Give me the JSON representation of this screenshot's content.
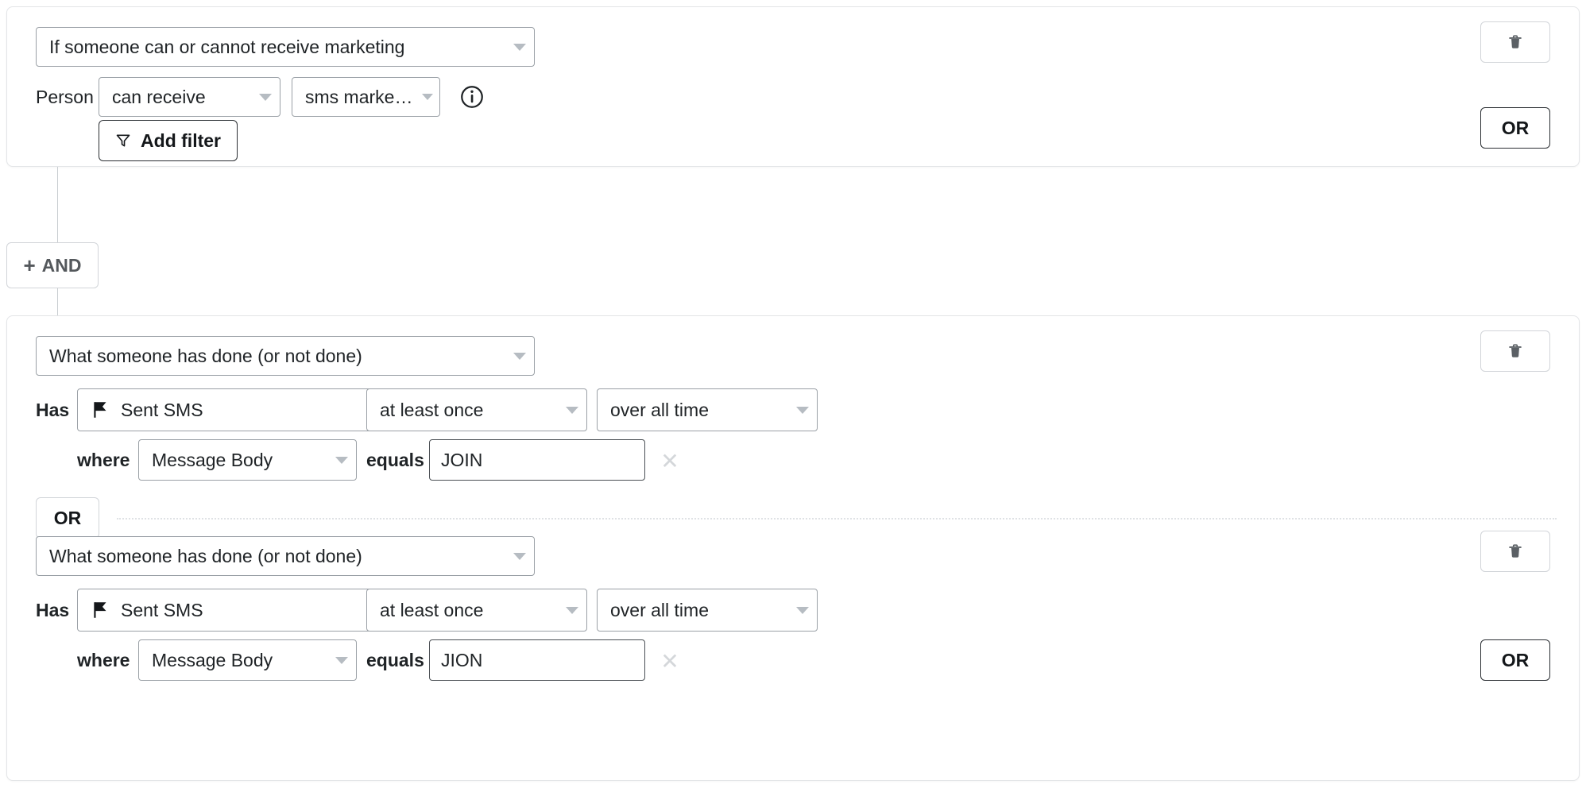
{
  "blocks": [
    {
      "id": "block-1",
      "type_select": {
        "value": "If someone can or cannot receive marketing"
      },
      "row_label": "Person",
      "consent_select": {
        "value": "can receive"
      },
      "channel_select": {
        "value": "sms marketing"
      },
      "info_icon": "info-icon",
      "add_filter_label": "Add filter",
      "delete_icon": "trash-icon",
      "or_label": "OR"
    },
    {
      "id": "block-2",
      "subblocks": [
        {
          "type_select": {
            "value": "What someone has done (or not done)"
          },
          "has_label": "Has",
          "metric_select": {
            "value": "Sent SMS",
            "icon": "sms-flag-icon"
          },
          "frequency_select": {
            "value": "at least once"
          },
          "timeframe_select": {
            "value": "over all time"
          },
          "where_label": "where",
          "property_select": {
            "value": "Message Body"
          },
          "operator_label": "equals",
          "value_input": {
            "value": "JOIN",
            "placeholder": ""
          },
          "clear_icon": "close-icon",
          "delete_icon": "trash-icon"
        },
        {
          "type_select": {
            "value": "What someone has done (or not done)"
          },
          "has_label": "Has",
          "metric_select": {
            "value": "Sent SMS",
            "icon": "sms-flag-icon"
          },
          "frequency_select": {
            "value": "at least once"
          },
          "timeframe_select": {
            "value": "over all time"
          },
          "where_label": "where",
          "property_select": {
            "value": "Message Body"
          },
          "operator_label": "equals",
          "value_input": {
            "value": "JION",
            "placeholder": ""
          },
          "clear_icon": "close-icon",
          "delete_icon": "trash-icon"
        }
      ],
      "inner_or_label": "OR",
      "or_label": "OR"
    }
  ],
  "connector": {
    "and_label": "AND",
    "plus_glyph": "+"
  },
  "colors": {
    "card_border": "#e3e5e7",
    "select_border": "#9aa0a6",
    "input_border": "#4a4f54",
    "button_border": "#2b2f33",
    "light_border": "#d2d5d9",
    "text": "#1f2326",
    "muted": "#b6bcc2",
    "flag_icon": "#14171a"
  }
}
